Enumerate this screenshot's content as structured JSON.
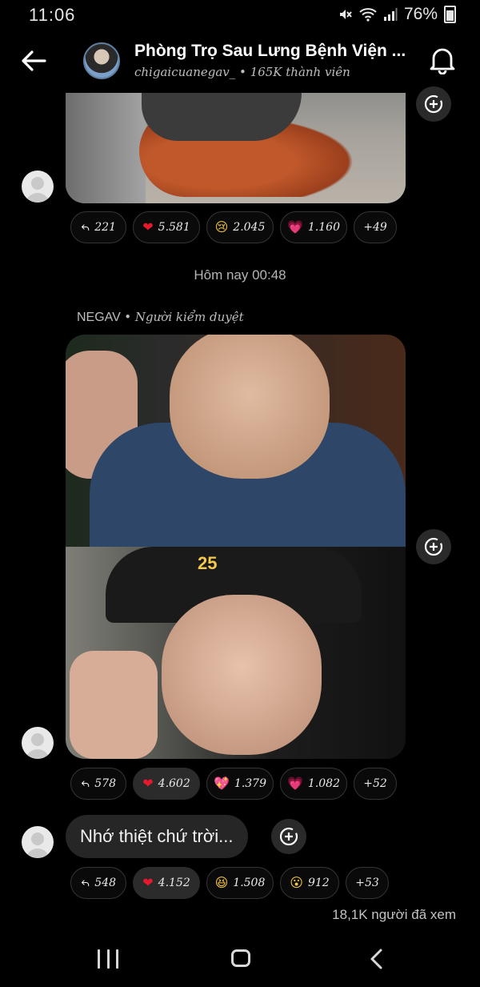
{
  "status_bar": {
    "time": "11:06",
    "battery": "76%"
  },
  "header": {
    "title": "Phòng Trọ Sau Lưng Bệnh Viện ...",
    "subtitle": "chigaicuanegav_ • 165K thành viên"
  },
  "messages": {
    "first_reactions": [
      {
        "icon": "reply-icon",
        "emoji": "↩",
        "count": "221"
      },
      {
        "icon": "red-heart-icon",
        "emoji": "❤",
        "count": "5.581"
      },
      {
        "icon": "sad-face-icon",
        "emoji": "😢",
        "count": "2.045"
      },
      {
        "icon": "pink-heart-icon",
        "emoji": "💗",
        "count": "1.160"
      },
      {
        "icon": "more-reactions",
        "emoji": "",
        "count": "+49"
      }
    ],
    "timestamp": "Hôm nay 00:48",
    "sender_name": "NEGAV",
    "sender_role": "• Người kiểm duyệt",
    "photo_reactions": [
      {
        "icon": "reply-icon",
        "emoji": "↩",
        "count": "578"
      },
      {
        "icon": "red-heart-icon",
        "emoji": "❤",
        "count": "4.602"
      },
      {
        "icon": "sparkling-heart-icon",
        "emoji": "💖",
        "count": "1.379"
      },
      {
        "icon": "pink-heart-icon",
        "emoji": "💗",
        "count": "1.082"
      },
      {
        "icon": "more-reactions",
        "emoji": "",
        "count": "+52"
      }
    ],
    "text_message": "Nhớ thiệt chứ trời...",
    "text_reactions": [
      {
        "icon": "reply-icon",
        "emoji": "↩",
        "count": "548"
      },
      {
        "icon": "red-heart-icon",
        "emoji": "❤",
        "count": "4.152"
      },
      {
        "icon": "grinning-face-icon",
        "emoji": "😆",
        "count": "1.508"
      },
      {
        "icon": "surprised-face-icon",
        "emoji": "😮",
        "count": "912"
      },
      {
        "icon": "more-reactions",
        "emoji": "",
        "count": "+53"
      }
    ],
    "seen_count": "18,1K người đã xem"
  },
  "photo_text": {
    "cap_print": "25"
  },
  "colors": {
    "background": "#000000",
    "chip_active": "#2b2b2b",
    "bubble": "#262626"
  }
}
